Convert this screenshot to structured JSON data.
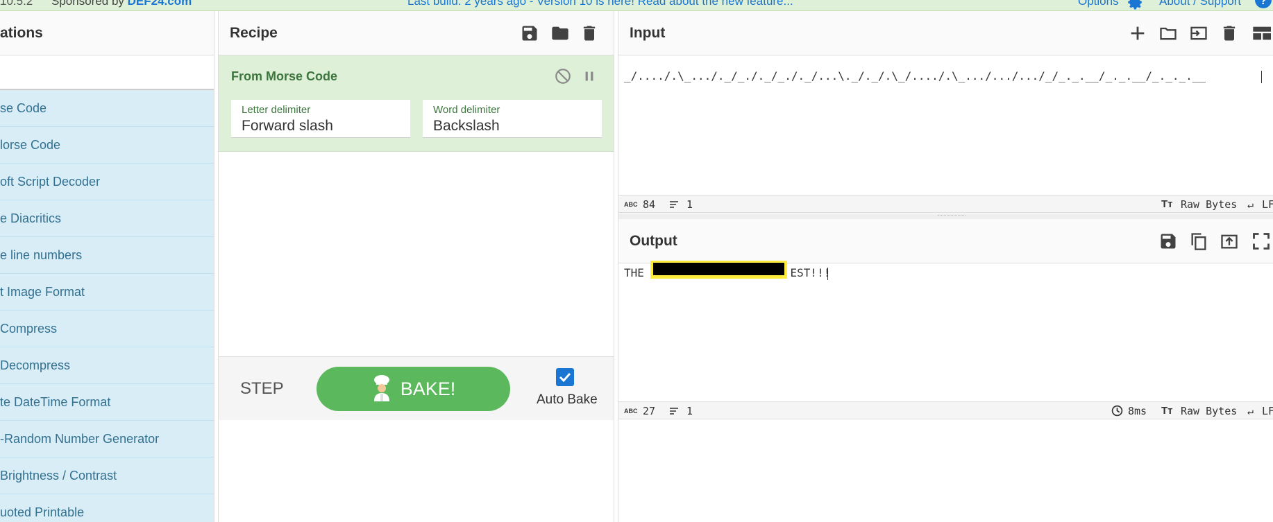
{
  "banner": {
    "version": "10.5.2",
    "sponsored_prefix": "Sponsored by",
    "sponsor_name": "DEF24.com",
    "build_note": "Last build: 2 years ago - Version 10 is here! Read about the new feature...",
    "options_label": "Options",
    "about_label": "About / Support"
  },
  "operations": {
    "title": "ations",
    "search_placeholder": "",
    "items": [
      "se Code",
      "lorse Code",
      "oft Script Decoder",
      "e Diacritics",
      "e line numbers",
      "t Image Format",
      "Compress",
      "Decompress",
      "te DateTime Format",
      "-Random Number Generator",
      "Brightness / Contrast",
      "uoted Printable"
    ]
  },
  "recipe": {
    "title": "Recipe",
    "operation": {
      "name": "From Morse Code",
      "args": [
        {
          "label": "Letter delimiter",
          "value": "Forward slash"
        },
        {
          "label": "Word delimiter",
          "value": "Backslash"
        }
      ]
    },
    "step_label": "STEP",
    "bake_label": "BAKE!",
    "auto_bake_label": "Auto Bake",
    "auto_bake_checked": true
  },
  "input": {
    "title": "Input",
    "text": "_/..../.\\_.../._/_./._/_./._/...\\._/._/.\\_/..../.\\_.../.../.../_/_._.__/_._.__/_._._.__",
    "status": {
      "length": "84",
      "lines": "1",
      "encoding": "Raw Bytes",
      "eol": "LF"
    }
  },
  "output": {
    "title": "Output",
    "text_prefix": "THE ",
    "text_suffix": "EST!!!",
    "status": {
      "length": "27",
      "lines": "1",
      "time": "8ms",
      "encoding": "Raw Bytes",
      "eol": "LF"
    }
  },
  "colors": {
    "accent": "#1976d2",
    "bake_green": "#5cb85c",
    "recipe_op_bg": "#dff0d8",
    "ops_list_bg": "#d9edf7",
    "highlight_yellow": "#ffeb3b"
  }
}
